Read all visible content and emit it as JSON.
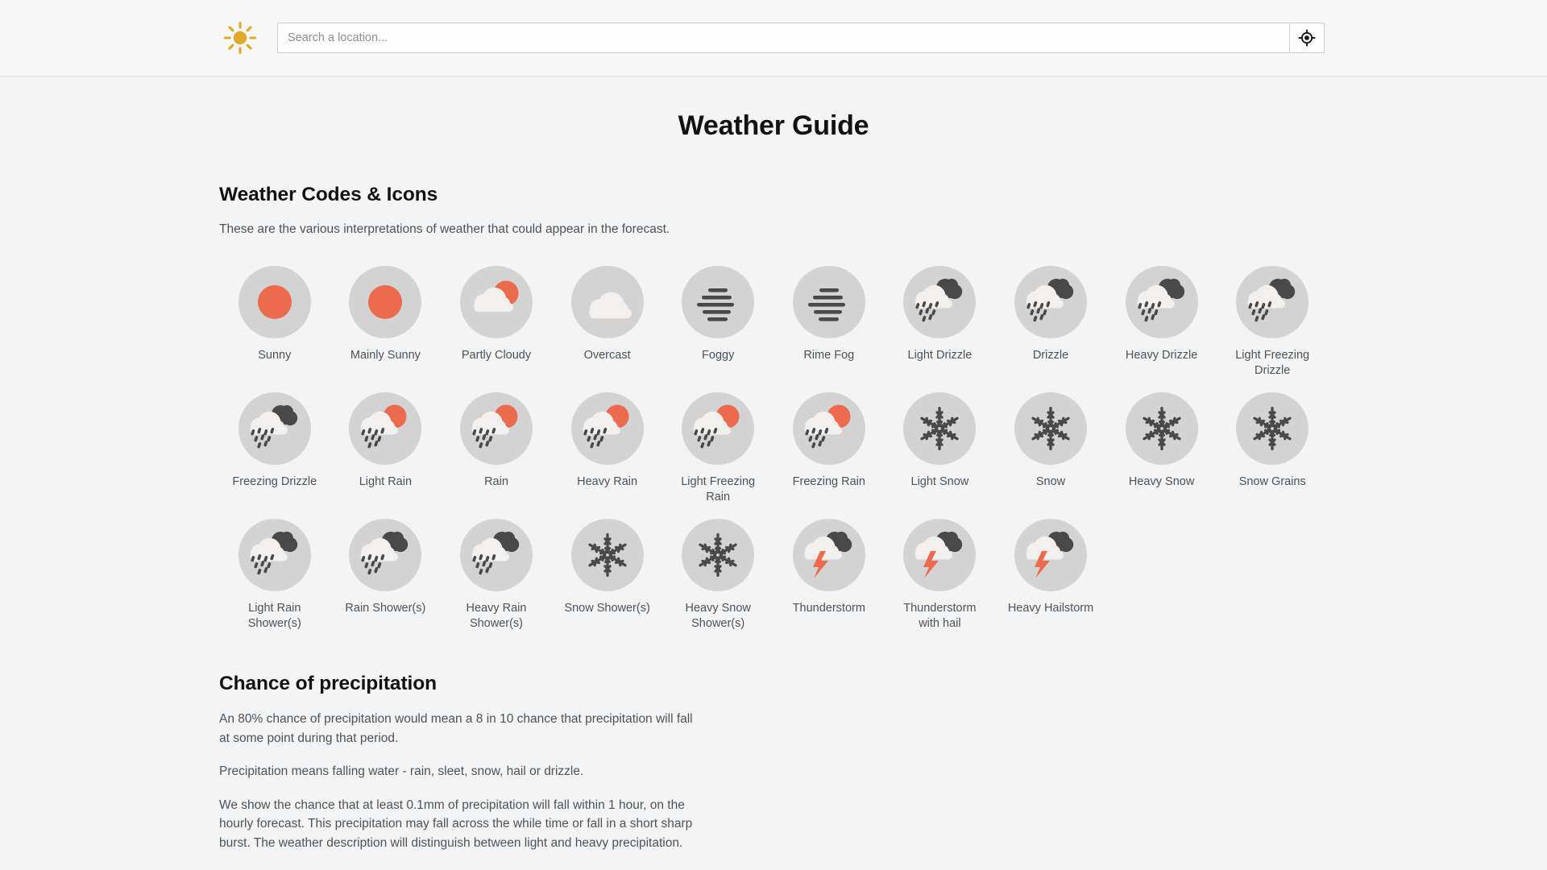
{
  "header": {
    "logo_icon": "sun-icon",
    "search": {
      "placeholder": "Search a location...",
      "value": ""
    },
    "gps_button_icon": "crosshair-location-icon"
  },
  "page": {
    "title": "Weather Guide"
  },
  "codes_section": {
    "heading": "Weather Codes & Icons",
    "subtitle": "These are the various interpretations of weather that could appear in the forecast.",
    "items": [
      {
        "label": "Sunny",
        "icon": "sun-icon"
      },
      {
        "label": "Mainly Sunny",
        "icon": "sun-icon"
      },
      {
        "label": "Partly Cloudy",
        "icon": "sun-behind-cloud-icon"
      },
      {
        "label": "Overcast",
        "icon": "cloud-icon"
      },
      {
        "label": "Foggy",
        "icon": "fog-icon"
      },
      {
        "label": "Rime Fog",
        "icon": "fog-icon"
      },
      {
        "label": "Light Drizzle",
        "icon": "cloud-dark-drizzle-icon"
      },
      {
        "label": "Drizzle",
        "icon": "cloud-dark-drizzle-icon"
      },
      {
        "label": "Heavy Drizzle",
        "icon": "cloud-dark-drizzle-icon"
      },
      {
        "label": "Light Freezing Drizzle",
        "icon": "cloud-dark-drizzle-icon"
      },
      {
        "label": "Freezing Drizzle",
        "icon": "cloud-dark-drizzle-icon"
      },
      {
        "label": "Light Rain",
        "icon": "sun-cloud-rain-icon"
      },
      {
        "label": "Rain",
        "icon": "sun-cloud-rain-icon"
      },
      {
        "label": "Heavy Rain",
        "icon": "sun-cloud-rain-icon"
      },
      {
        "label": "Light Freezing Rain",
        "icon": "sun-cloud-rain-icon"
      },
      {
        "label": "Freezing Rain",
        "icon": "sun-cloud-rain-icon"
      },
      {
        "label": "Light Snow",
        "icon": "snowflake-icon"
      },
      {
        "label": "Snow",
        "icon": "snowflake-icon"
      },
      {
        "label": "Heavy Snow",
        "icon": "snowflake-icon"
      },
      {
        "label": "Snow Grains",
        "icon": "snowflake-icon"
      },
      {
        "label": "Light Rain Shower(s)",
        "icon": "cloud-dark-drizzle-icon"
      },
      {
        "label": "Rain Shower(s)",
        "icon": "cloud-dark-drizzle-icon"
      },
      {
        "label": "Heavy Rain Shower(s)",
        "icon": "cloud-dark-drizzle-icon"
      },
      {
        "label": "Snow Shower(s)",
        "icon": "snowflake-icon"
      },
      {
        "label": "Heavy Snow Shower(s)",
        "icon": "snowflake-icon"
      },
      {
        "label": "Thunderstorm",
        "icon": "cloud-lightning-icon"
      },
      {
        "label": "Thunderstorm with hail",
        "icon": "cloud-lightning-icon"
      },
      {
        "label": "Heavy Hailstorm",
        "icon": "cloud-lightning-icon"
      }
    ]
  },
  "precipitation_section": {
    "heading": "Chance of precipitation",
    "paragraphs": [
      "An 80% chance of precipitation would mean a 8 in 10 chance that precipitation will fall at some point during that period.",
      "Precipitation means falling water - rain, sleet, snow, hail or drizzle.",
      "We show the chance that at least 0.1mm of precipitation will fall within 1 hour, on the hourly forecast. This precipitation may fall across the while time or fall in a short sharp burst. The weather description will distinguish between light and heavy precipitation."
    ]
  },
  "colors": {
    "sun_orange": "#ec6b4f",
    "logo_gold": "#dfa92b",
    "bubble_gray": "#d3d3d3",
    "cloud_light": "#f2f0ee",
    "cloud_dark": "#494949",
    "text_body": "#4b5358",
    "page_bg": "#f4f4f4"
  }
}
